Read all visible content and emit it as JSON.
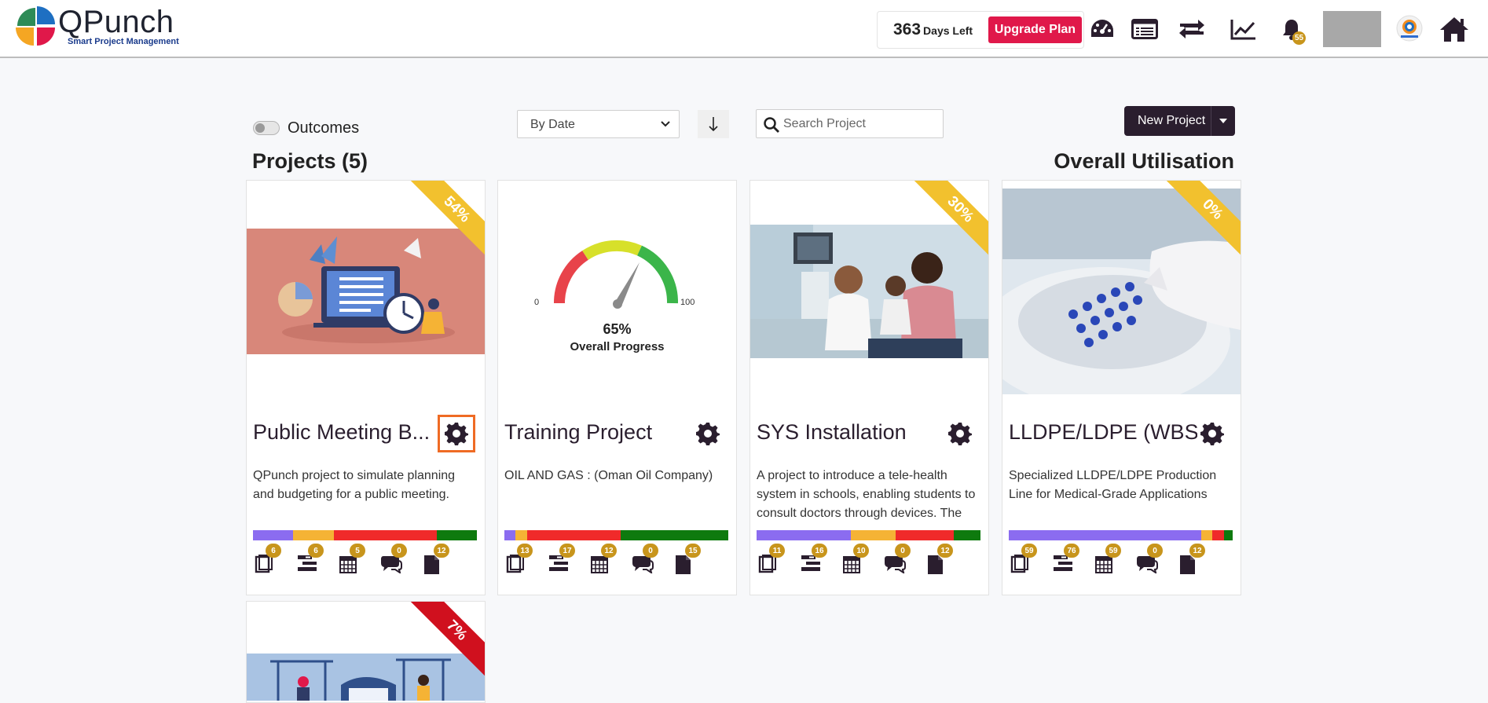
{
  "header": {
    "logo_name": "QPunch",
    "logo_tagline": "Smart Project Management",
    "days_left_number": "363",
    "days_left_label": "Days Left",
    "upgrade_label": "Upgrade Plan",
    "notification_count": "55"
  },
  "toolbar": {
    "outcomes_label": "Outcomes",
    "sort_value": "By Date",
    "search_placeholder": "Search Project",
    "new_project_label": "New Project"
  },
  "section": {
    "projects_title": "Projects (5)",
    "utilisation_title": "Overall Utilisation"
  },
  "projects": [
    {
      "ribbon": "54%",
      "title": "Public Meeting B...",
      "description": "QPunch project to simulate planning and budgeting for a public meeting.",
      "status_segments": [
        {
          "color": "#8b6cf0",
          "fraction": 0.18
        },
        {
          "color": "#f5b335",
          "fraction": 0.18
        },
        {
          "color": "#f02a2a",
          "fraction": 0.46
        },
        {
          "color": "#0e7a0e",
          "fraction": 0.18
        }
      ],
      "stats": [
        "6",
        "6",
        "5",
        "0",
        "12"
      ]
    },
    {
      "title": "Training Project",
      "description": "OIL AND GAS : (Oman Oil Company)",
      "gauge_value": "65%",
      "gauge_label": "Overall Progress",
      "gauge_min": "0",
      "gauge_max": "100",
      "status_segments": [
        {
          "color": "#8b6cf0",
          "fraction": 0.05
        },
        {
          "color": "#f5b335",
          "fraction": 0.05
        },
        {
          "color": "#f02a2a",
          "fraction": 0.42
        },
        {
          "color": "#0e7a0e",
          "fraction": 0.48
        }
      ],
      "stats": [
        "13",
        "17",
        "12",
        "0",
        "15"
      ]
    },
    {
      "ribbon": "30%",
      "title": "SYS Installation",
      "description": "A project to introduce a tele-health system in schools, enabling students to consult doctors through devices. The",
      "status_segments": [
        {
          "color": "#8b6cf0",
          "fraction": 0.42
        },
        {
          "color": "#f5b335",
          "fraction": 0.2
        },
        {
          "color": "#f02a2a",
          "fraction": 0.26
        },
        {
          "color": "#0e7a0e",
          "fraction": 0.12
        }
      ],
      "stats": [
        "11",
        "16",
        "10",
        "0",
        "12"
      ]
    },
    {
      "ribbon": "0%",
      "title": "LLDPE/LDPE (WBS)",
      "description": "Specialized LLDPE/LDPE Production Line for Medical-Grade Applications",
      "status_segments": [
        {
          "color": "#8b6cf0",
          "fraction": 0.86
        },
        {
          "color": "#f5b335",
          "fraction": 0.05
        },
        {
          "color": "#f02a2a",
          "fraction": 0.05
        },
        {
          "color": "#0e7a0e",
          "fraction": 0.04
        }
      ],
      "stats": [
        "59",
        "76",
        "59",
        "0",
        "12"
      ]
    },
    {
      "ribbon": "7%"
    }
  ],
  "colors": {
    "accent_dark": "#2a1e2e",
    "upgrade_red": "#e0184a",
    "ribbon_yellow": "#f2c12e",
    "ribbon_red": "#d0101e",
    "badge_gold": "#c8951c",
    "selected_outline": "#ef6b24"
  },
  "icons": [
    "dashboard-gauge-icon",
    "list-view-icon",
    "sync-icon",
    "analytics-icon",
    "bell-icon",
    "home-icon",
    "search-icon",
    "gear-icon",
    "book-icon",
    "gantt-icon",
    "calendar-icon",
    "chat-icon",
    "document-icon"
  ]
}
